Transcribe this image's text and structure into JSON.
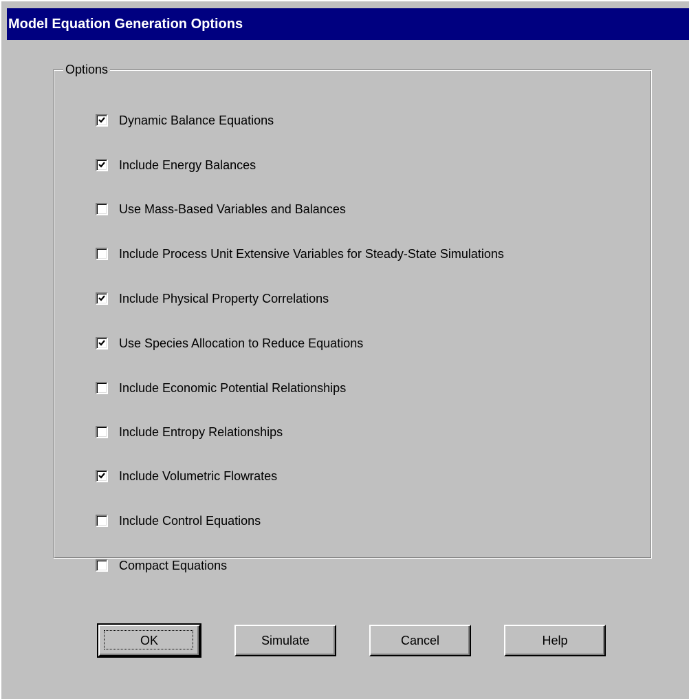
{
  "window": {
    "title": "Model Equation Generation Options"
  },
  "group": {
    "label": "Options"
  },
  "options": [
    {
      "label": "Dynamic Balance Equations",
      "checked": true
    },
    {
      "label": "Include Energy Balances",
      "checked": true
    },
    {
      "label": "Use Mass-Based Variables and Balances",
      "checked": false
    },
    {
      "label": "Include Process Unit Extensive Variables for Steady-State Simulations",
      "checked": false
    },
    {
      "label": "Include Physical Property Correlations",
      "checked": true
    },
    {
      "label": "Use Species Allocation to Reduce Equations",
      "checked": true
    },
    {
      "label": "Include Economic Potential Relationships",
      "checked": false
    },
    {
      "label": "Include Entropy Relationships",
      "checked": false
    },
    {
      "label": "Include Volumetric Flowrates",
      "checked": true
    },
    {
      "label": "Include Control Equations",
      "checked": false
    },
    {
      "label": "Compact Equations",
      "checked": false
    }
  ],
  "buttons": {
    "ok": "OK",
    "simulate": "Simulate",
    "cancel": "Cancel",
    "help": "Help"
  },
  "colors": {
    "titlebar": "#000080",
    "face": "#c0c0c0"
  }
}
